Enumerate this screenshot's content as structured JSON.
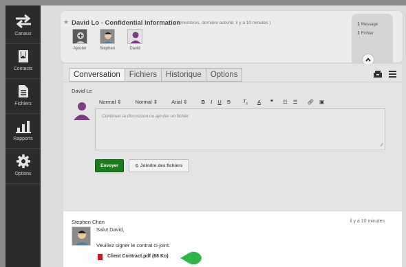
{
  "sidebar": {
    "items": [
      {
        "label": "Canaux",
        "icon": "swap-arrows-icon"
      },
      {
        "label": "Contacts",
        "icon": "address-book-icon"
      },
      {
        "label": "Fichiers",
        "icon": "document-icon"
      },
      {
        "label": "Rapports",
        "icon": "bar-chart-icon"
      },
      {
        "label": "Options",
        "icon": "gear-icon"
      }
    ]
  },
  "header": {
    "title": "David Lo - Confidential Information",
    "subtitle": "( 2 membres, dernière activité: il y a 10 minutes )",
    "members": [
      {
        "name": "Ajouter"
      },
      {
        "name": "Stephen"
      },
      {
        "name": "David"
      }
    ],
    "stats": {
      "messages_count": "1",
      "messages_label": "Message",
      "files_count": "1",
      "files_label": "Fichier"
    }
  },
  "tabs": [
    "Conversation",
    "Fichiers",
    "Historique",
    "Options"
  ],
  "composer": {
    "author": "David Le",
    "toolbar": {
      "style_select": "Normal",
      "size_select": "Normal",
      "font_select": "Arial"
    },
    "placeholder": "Continuer la discussion ou ajouter un fichier",
    "send_label": "Envoyer",
    "attach_label": "Joindre des fichiers"
  },
  "message": {
    "author": "Stephen Chen",
    "time": "il y a 10 minutes",
    "line1": "Salut David,",
    "line2": "Veuillez signer le contrat ci-joint.",
    "attachment": "Client Contract.pdf (68 Ko)"
  },
  "colors": {
    "sidebar_bg": "#2b2b2b",
    "send_button": "#1e7a1e",
    "pointer": "#2fb44b",
    "pdf_icon": "#c81e1e"
  }
}
